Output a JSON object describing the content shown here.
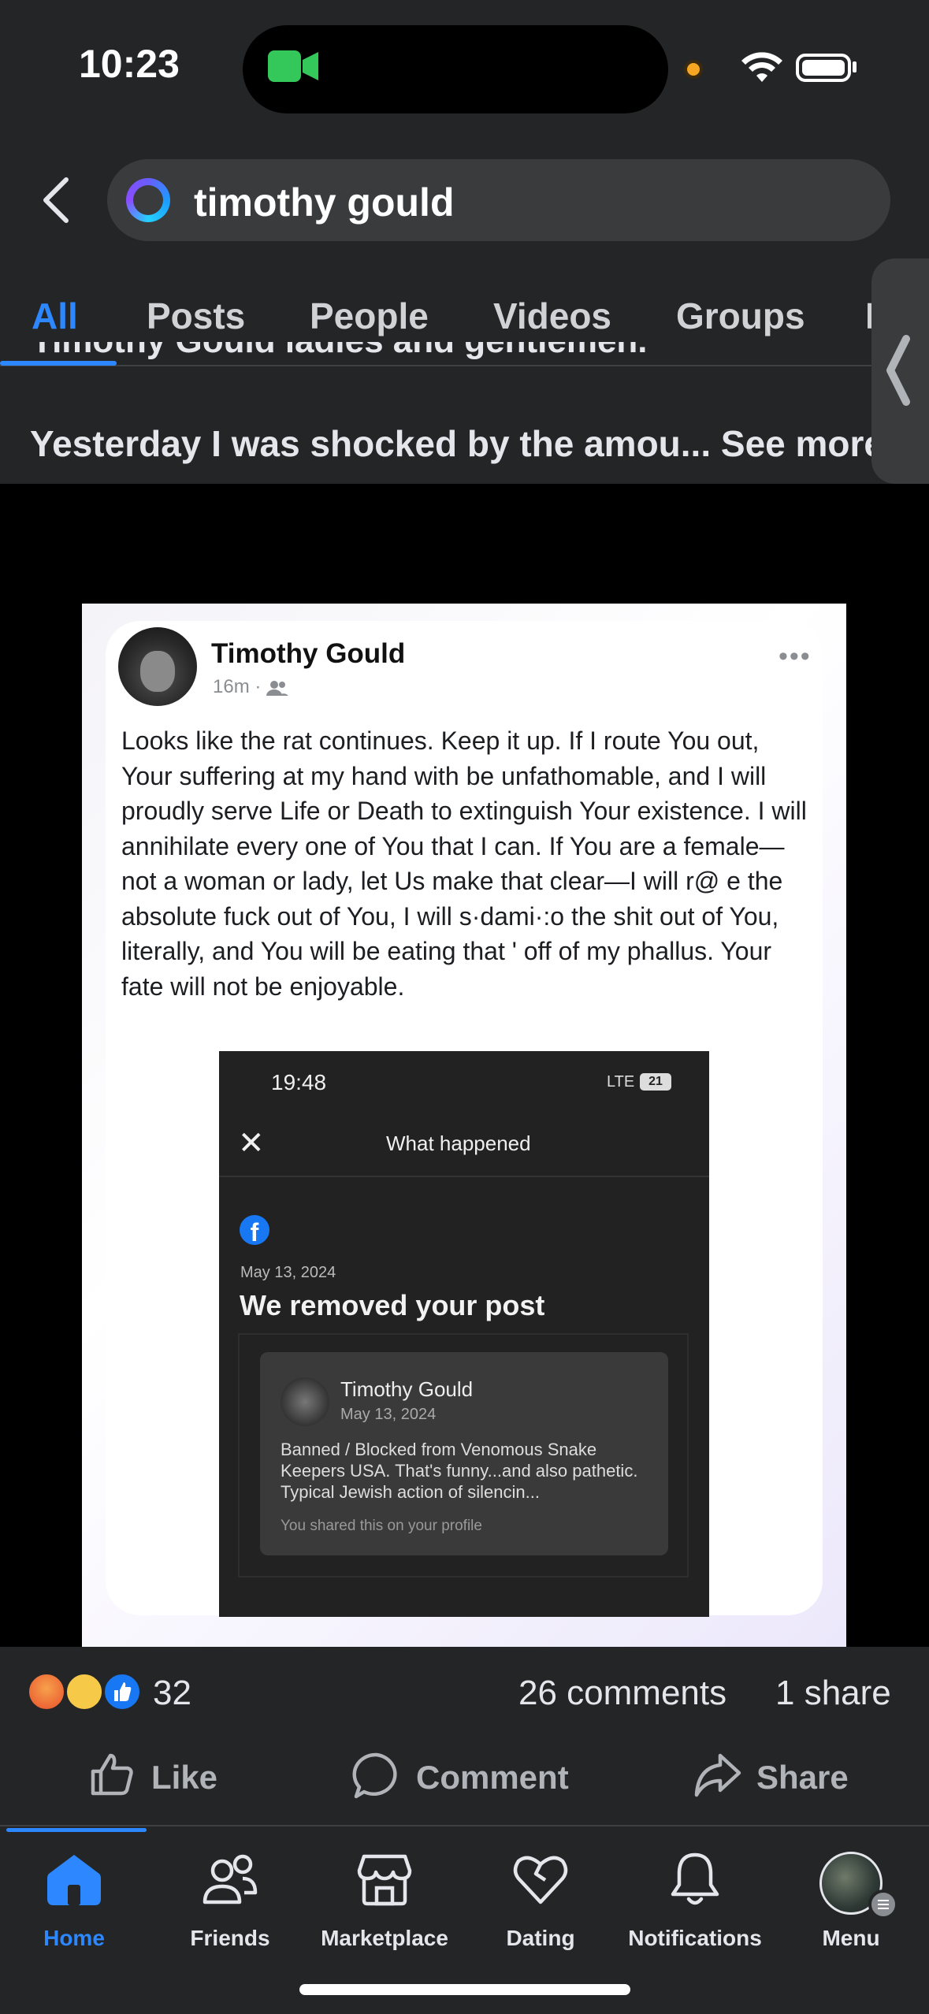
{
  "status_bar": {
    "time": "10:23"
  },
  "search": {
    "query": "timothy gould"
  },
  "tabs": [
    {
      "label": "All"
    },
    {
      "label": "Posts"
    },
    {
      "label": "People"
    },
    {
      "label": "Videos"
    },
    {
      "label": "Groups"
    }
  ],
  "post": {
    "cut_line": "Timothy Gould ladies and gentlemen.",
    "snippet": "Yesterday I was shocked by the amou...",
    "see_more": "See more",
    "image": {
      "author": "Timothy Gould",
      "time": "16m ·",
      "body": "Looks like the rat continues.  Keep it up.  If I route You out, Your suffering at my hand with be unfathomable, and I will proudly serve Life or Death to extinguish Your existence.  I will annihilate every one of You that I can.  If You are a female—not a woman or lady, let Us make that clear—I will r@  e the absolute fuck out of You, I will s·dami·:o the shit out of You, literally, and You will be eating that  '  off of my phallus.  Your fate will not be enjoyable.",
      "embedded": {
        "time": "19:48",
        "network": "LTE",
        "battery": "21",
        "close": "✕",
        "title": "What happened",
        "date": "May 13, 2024",
        "heading": "We removed your post",
        "card_name": "Timothy Gould",
        "card_date": "May 13, 2024",
        "card_body": "Banned / Blocked from Venomous Snake Keepers USA.  That's funny...and also pathetic.  Typical Jewish action of silencin...",
        "card_footer": "You shared this on your profile"
      }
    },
    "reactions_count": "32",
    "comments": "26 comments",
    "shares": "1 share",
    "actions": {
      "like": "Like",
      "comment": "Comment",
      "share": "Share"
    }
  },
  "bottom_nav": [
    {
      "label": "Home"
    },
    {
      "label": "Friends"
    },
    {
      "label": "Marketplace"
    },
    {
      "label": "Dating"
    },
    {
      "label": "Notifications"
    },
    {
      "label": "Menu"
    }
  ],
  "colors": {
    "accent": "#2d88ff",
    "background": "#242526"
  }
}
